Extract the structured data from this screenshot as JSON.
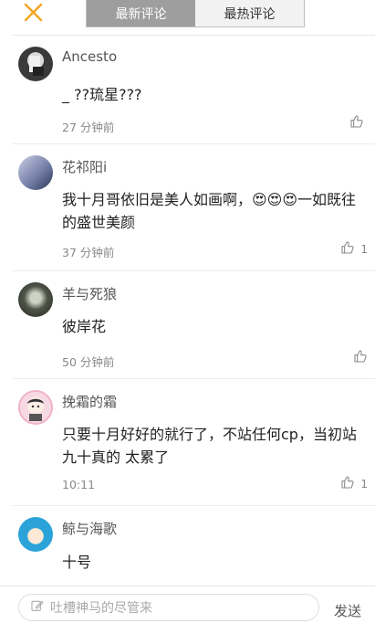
{
  "header": {
    "tabs": [
      {
        "label": "最新评论",
        "active": true
      },
      {
        "label": "最热评论",
        "active": false
      }
    ],
    "close_icon": "close-x-icon",
    "accent_color": "#f5a623"
  },
  "comments": [
    {
      "name": "Ancesto",
      "content": "_ ??琉星???",
      "time": "27 分钟前",
      "likes": ""
    },
    {
      "name": "花祁阳i",
      "content": "我十月哥依旧是美人如画啊，😍😍😍一如既往的盛世美颜",
      "time": "37 分钟前",
      "likes": "1"
    },
    {
      "name": "羊与死狼",
      "content": "彼岸花",
      "time": "50 分钟前",
      "likes": ""
    },
    {
      "name": "挽霜的霜",
      "content": "只要十月好好的就行了，不站任何cp，当初站九十真的 太累了",
      "time": "10:11",
      "likes": "1"
    },
    {
      "name": "鲸与海歌",
      "content": "十号",
      "time": "",
      "likes": ""
    }
  ],
  "composer": {
    "placeholder": "吐槽神马的尽管来",
    "send_label": "发送",
    "edit_icon": "edit-icon"
  }
}
